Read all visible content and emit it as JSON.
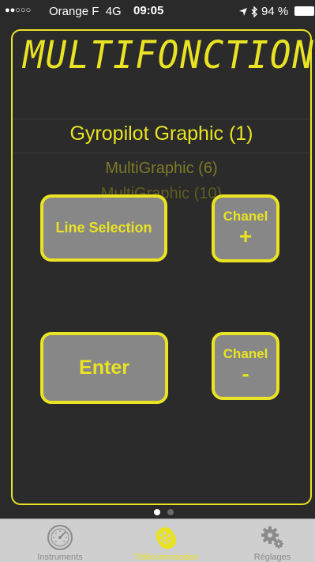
{
  "status_bar": {
    "signal": "●●○○○",
    "carrier": "Orange F",
    "network": "4G",
    "time": "09:05",
    "battery": "94 %"
  },
  "header": {
    "title": "MULTIFONCTION"
  },
  "picker": {
    "selected": "Gyropilot Graphic (1)",
    "options": [
      "MultiGraphic (6)",
      "MultiGraphic (10)"
    ]
  },
  "buttons": {
    "line_selection": "Line Selection",
    "chanel_plus_label": "Chanel",
    "chanel_plus_symbol": "+",
    "enter": "Enter",
    "chanel_minus_label": "Chanel",
    "chanel_minus_symbol": "-"
  },
  "tabbar": {
    "tabs": [
      {
        "label": "Instruments",
        "icon": "gauge-icon"
      },
      {
        "label": "Télécommandes",
        "icon": "remote-icon",
        "active": true
      },
      {
        "label": "Réglages",
        "icon": "gears-icon"
      }
    ]
  },
  "colors": {
    "accent": "#e9e323",
    "button_fill": "#878787",
    "background": "#2a2a2a"
  }
}
